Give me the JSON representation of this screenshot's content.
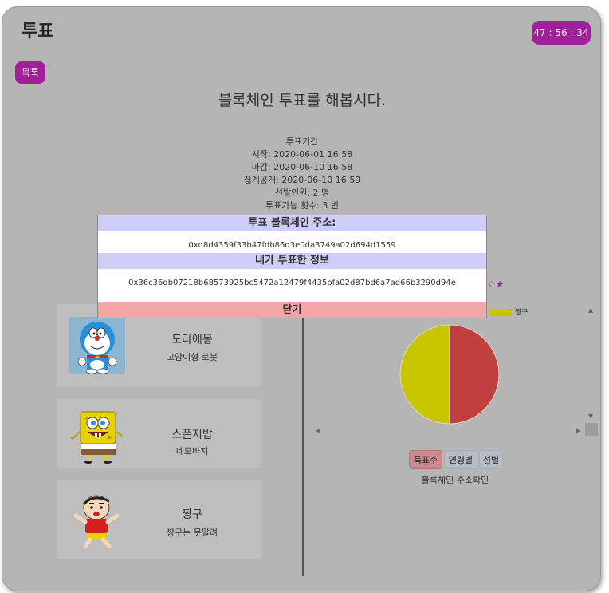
{
  "header": {
    "title": "투표",
    "timer": "47 : 56 : 34",
    "list_button": "목록"
  },
  "heading": "블록체인 투표를 해봅시다.",
  "period": {
    "label": "투표기간",
    "start": "시작: 2020-06-01 16:58",
    "end": "마감: 2020-06-10 16:58",
    "tally": "집계공개: 2020-06-10 16:59",
    "elected": "선발인원: 2 명",
    "vote_count": "투표가능 횟수: 3 번"
  },
  "stars": "☆★",
  "candidates": [
    {
      "name": "도라에몽",
      "desc": "고양이형 로봇"
    },
    {
      "name": "스폰지밥",
      "desc": "네모바지"
    },
    {
      "name": "짱구",
      "desc": "짱구는 못말려"
    }
  ],
  "chart_data": {
    "type": "pie",
    "categories": [
      "짱구"
    ],
    "legend": "top-right",
    "slices": [
      {
        "label": "",
        "value": 50,
        "color": "#c04040"
      },
      {
        "label": "짱구",
        "value": 50,
        "color": "#c7c400"
      }
    ]
  },
  "tabs": {
    "votes": "득표수",
    "age": "연령별",
    "gender": "성별"
  },
  "verify_label": "블록체인 주소확인",
  "modal": {
    "address_title": "투표 블록체인 주소:",
    "address_value": "0xd8d4359f33b47fdb86d3e0da3749a02d694d1559",
    "my_vote_title": "내가 투표한 정보",
    "my_vote_value": "0x36c36db07218b68573925bc5472a12479f4435bfa02d87bd6a7ad66b3290d94e",
    "close_label": "닫기"
  }
}
